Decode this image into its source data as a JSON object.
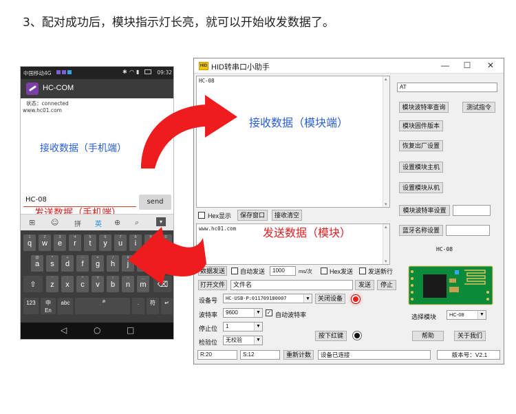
{
  "heading": "3、配对成功后，模块指示灯长亮，就可以开始收发数据了。",
  "phone": {
    "status_left": "中国移动4G",
    "status_right": "09:32",
    "app_title": "HC-COM",
    "state": "状态：connected",
    "received_text": "www.hc01.com",
    "annotation_receive": "接收数据（手机端）",
    "input_value": "HC-08",
    "send_label": "send",
    "annotation_send": "发送数据（手机端）",
    "ime_items": [
      "拼",
      "英",
      "⌕"
    ],
    "keyboard": {
      "row1": [
        {
          "k": "q",
          "s": "1"
        },
        {
          "k": "w",
          "s": "2"
        },
        {
          "k": "e",
          "s": "3"
        },
        {
          "k": "r",
          "s": "4"
        },
        {
          "k": "t",
          "s": "5"
        },
        {
          "k": "y",
          "s": "6"
        },
        {
          "k": "u",
          "s": "7"
        },
        {
          "k": "i",
          "s": "8"
        },
        {
          "k": "o",
          "s": "9"
        },
        {
          "k": "p",
          "s": "0"
        }
      ],
      "row2": [
        {
          "k": "a",
          "s": "@"
        },
        {
          "k": "s",
          "s": "*"
        },
        {
          "k": "d",
          "s": "+"
        },
        {
          "k": "f",
          "s": "-"
        },
        {
          "k": "g",
          "s": "="
        },
        {
          "k": "h",
          "s": "/"
        },
        {
          "k": "j",
          "s": "#"
        },
        {
          "k": "k",
          "s": "("
        },
        {
          "k": "l",
          "s": ")"
        }
      ],
      "row3": [
        {
          "k": "z",
          "s": "'"
        },
        {
          "k": "x",
          "s": ":"
        },
        {
          "k": "c",
          "s": "\""
        },
        {
          "k": "v",
          "s": "?"
        },
        {
          "k": "b",
          "s": "!"
        },
        {
          "k": "n",
          "s": "~"
        },
        {
          "k": "m",
          "s": "…"
        }
      ],
      "row4": [
        "123",
        "中\nEn",
        "abc",
        "🎤",
        ".",
        "符",
        "↵"
      ]
    },
    "nav": [
      "◁",
      "○",
      "□"
    ]
  },
  "window": {
    "logo": "HID",
    "title": "HID转串口小助手",
    "controls": [
      "—",
      "☐",
      "✕"
    ],
    "receive_text": "HC-08",
    "receive_annotation": "接收数据（模块端）",
    "hex_display": "Hex显示",
    "save_window": "保存窗口",
    "clear_receive": "接收清空",
    "send_text": "www.hc01.com",
    "send_annotation": "发送数据（模块）",
    "at_field": "AT",
    "right_buttons": {
      "baud_query": "模块波特率查询",
      "test_cmd": "测试指令",
      "firmware": "模块固件版本",
      "factory_reset": "恢复出厂设置",
      "set_master": "设置模块主机",
      "set_slave": "设置模块从机",
      "baud_set": "模块波特率设置",
      "bt_name_set": "蓝牙名称设置"
    },
    "module_name": "HC-08",
    "data_send": "数据发送",
    "auto_send": "自动发送",
    "interval": "1000",
    "interval_unit": "ms/次",
    "hex_send": "Hex发送",
    "send_newline": "发送新行",
    "open_file": "打开文件",
    "filename": "文件名",
    "send": "发送",
    "stop": "停止",
    "device_label": "设备号",
    "device_value": "HC-USB-P:011709180007",
    "close_device": "关闭设备",
    "baud_label": "波特率",
    "baud_value": "9600",
    "auto_baud": "自动波特率",
    "stopbit_label": "停止位",
    "stopbit_value": "1",
    "parity_label": "检验位",
    "parity_value": "无校验",
    "press_red_key": "按下红键",
    "select_module_label": "选择模块",
    "select_module_value": "HC-08",
    "help": "帮助",
    "about": "关于我们",
    "rx_count": "R:20",
    "tx_count": "S:12",
    "recount": "重新计数",
    "status": "设备已连接",
    "version": "版本号：V2.1"
  },
  "colors": {
    "annotation_blue": "#2a5fd8",
    "annotation_red": "#e02020",
    "arrow_red": "#ee1c1c"
  }
}
